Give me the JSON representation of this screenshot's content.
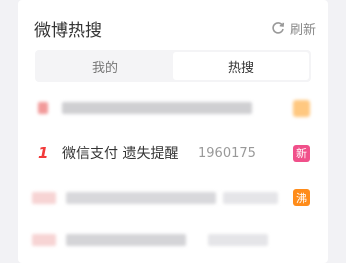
{
  "panel": {
    "title": "微博热搜",
    "refresh_label": "刷新"
  },
  "tabs": [
    {
      "label": "我的",
      "active": false
    },
    {
      "label": "热搜",
      "active": true
    }
  ],
  "featured_item": {
    "rank": "1",
    "topic": "微信支付 遗失提醒",
    "heat": "1960175",
    "badge": "新"
  },
  "blurred_badges": [
    "沸"
  ],
  "colors": {
    "rank_red": "#f23a3a",
    "badge_new": "#f0508a",
    "badge_hot": "#ff8c1a"
  }
}
